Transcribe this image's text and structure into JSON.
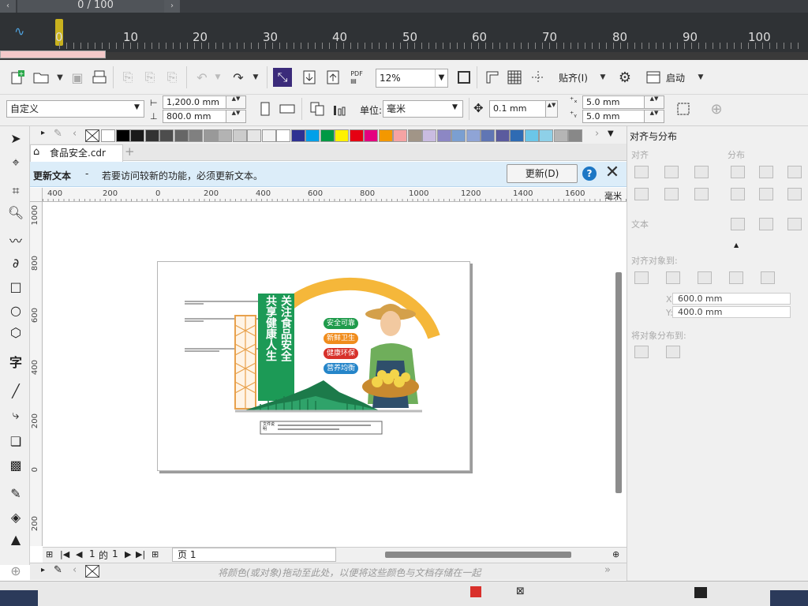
{
  "timeline": {
    "counter": "0 / 100",
    "ticks": [
      "0",
      "10",
      "20",
      "30",
      "40",
      "50",
      "60",
      "70",
      "80",
      "90",
      "100"
    ]
  },
  "toolbar": {
    "zoom": "12%",
    "snap_label": "贴齐(I)",
    "launch_label": "启动"
  },
  "property_bar": {
    "preset": "自定义",
    "width": "1,200.0 mm",
    "height": "800.0 mm",
    "unit_label": "单位:",
    "unit": "毫米",
    "nudge": "0.1 mm",
    "dup_x": "5.0 mm",
    "dup_y": "5.0 mm"
  },
  "document": {
    "tab": "食品安全.cdr"
  },
  "notice": {
    "title": "更新文本",
    "dash": "-",
    "message": "若要访问较新的功能，必须更新文本。",
    "button": "更新(D)"
  },
  "ruler": {
    "h": [
      "400",
      "200",
      "0",
      "200",
      "400",
      "600",
      "800",
      "1000",
      "1200",
      "1400",
      "1600"
    ],
    "unit": "毫米",
    "v": [
      "1000",
      "800",
      "600",
      "400",
      "200",
      "0",
      "200"
    ]
  },
  "artwork": {
    "slogan_right": "关注食品安全",
    "slogan_left": "共享健康人生",
    "tags": [
      "安全可靠",
      "新鲜卫生",
      "健康环保",
      "营养均衡"
    ],
    "tag_colors": [
      "#1f9b4b",
      "#f08c1c",
      "#d7312b",
      "#2585c9"
    ],
    "caption": "文件说明"
  },
  "pagebar": {
    "current": "1",
    "of": "的",
    "total": "1",
    "tab": "页 1"
  },
  "hint": "将颜色(或对象)拖动至此处，以便将这些颜色与文档存储在一起",
  "docker": {
    "title": "对齐与分布",
    "align": "对齐",
    "distribute": "分布",
    "text": "文本",
    "align_to": "对齐对象到:",
    "x": "600.0 mm",
    "y": "400.0 mm",
    "distribute_to": "将对象分布到:"
  },
  "palette_colors": [
    "#ffffff",
    "#000000",
    "#1a1a1a",
    "#333333",
    "#4d4d4d",
    "#666666",
    "#808080",
    "#999999",
    "#b3b3b3",
    "#cccccc",
    "#e6e6e6",
    "#f2f2f2",
    "#ffffff",
    "#2e3192",
    "#00a0e9",
    "#009944",
    "#fff100",
    "#e60012",
    "#e4007f",
    "#f39800",
    "#f5a3a3",
    "#a19587",
    "#c9bce1",
    "#8c87c4",
    "#7b9fd1",
    "#8fa4d6",
    "#6076b4",
    "#5b5b9e",
    "#2f6bb3",
    "#6bc6e8",
    "#8ed0e8",
    "#b5b5b5",
    "#888888"
  ]
}
